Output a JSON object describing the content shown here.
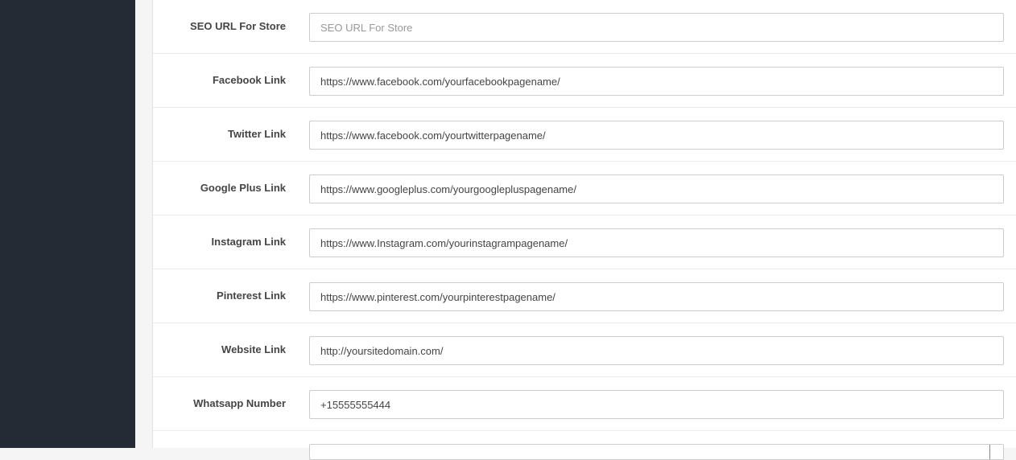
{
  "form": {
    "rows": [
      {
        "label": "SEO URL For Store",
        "value": "",
        "placeholder": "SEO URL For Store"
      },
      {
        "label": "Facebook Link",
        "value": "https://www.facebook.com/yourfacebookpagename/",
        "placeholder": ""
      },
      {
        "label": "Twitter Link",
        "value": "https://www.facebook.com/yourtwitterpagename/",
        "placeholder": ""
      },
      {
        "label": "Google Plus Link",
        "value": "https://www.googleplus.com/yourgooglepluspagename/",
        "placeholder": ""
      },
      {
        "label": "Instagram Link",
        "value": "https://www.Instagram.com/yourinstagrampagename/",
        "placeholder": ""
      },
      {
        "label": "Pinterest Link",
        "value": "https://www.pinterest.com/yourpinterestpagename/",
        "placeholder": ""
      },
      {
        "label": "Website Link",
        "value": "http://yoursitedomain.com/",
        "placeholder": ""
      },
      {
        "label": "Whatsapp Number",
        "value": "+15555555444",
        "placeholder": ""
      }
    ]
  },
  "colors": {
    "sidebar": "#242b35",
    "panel": "#ffffff",
    "label": "#454545",
    "border": "#cccccc"
  }
}
